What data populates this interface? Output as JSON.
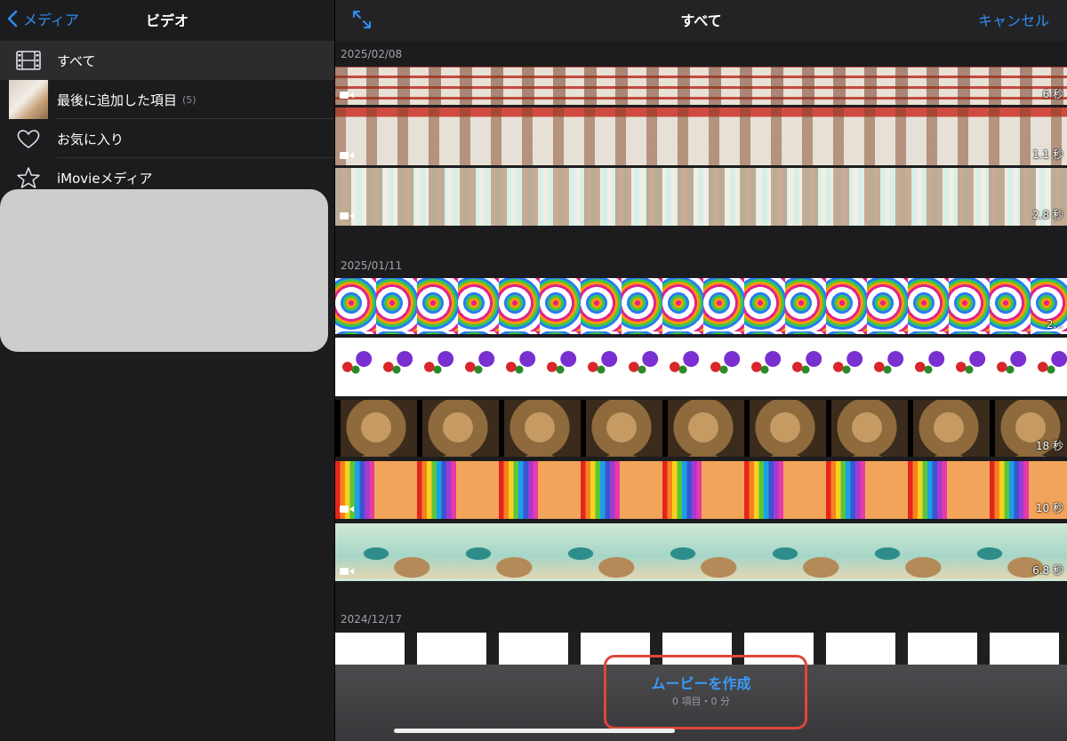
{
  "sidebar": {
    "back_label": "メディア",
    "title": "ビデオ",
    "items": [
      {
        "label": "すべて",
        "count": "",
        "icon": "film-icon",
        "selected": true
      },
      {
        "label": "最後に追加した項目",
        "count": "(5)",
        "icon": "recent-thumbnail",
        "selected": false
      },
      {
        "label": "お気に入り",
        "count": "",
        "icon": "heart-icon",
        "selected": false
      },
      {
        "label": "iMovieメディア",
        "count": "",
        "icon": "star-icon",
        "selected": false
      }
    ]
  },
  "main": {
    "title": "すべて",
    "cancel_label": "キャンセル",
    "groups": [
      {
        "date": "2025/02/08",
        "clips": [
          {
            "duration": "6 秒"
          },
          {
            "duration": "1.1 秒"
          },
          {
            "duration": "2.8 秒"
          }
        ]
      },
      {
        "date": "2025/01/11",
        "clips": [
          {
            "duration": "2..."
          },
          {
            "duration": ""
          },
          {
            "duration": "18 秒"
          },
          {
            "duration": "10 秒"
          },
          {
            "duration": "6.8 秒"
          }
        ]
      },
      {
        "date": "2024/12/17",
        "clips": [
          {
            "duration": ""
          }
        ]
      }
    ]
  },
  "bottom": {
    "create_label": "ムービーを作成",
    "summary": "0 項目・0 分"
  },
  "colors": {
    "accent": "#2f8ef5",
    "highlight": "#e0463a",
    "background": "#1c1c1e"
  }
}
